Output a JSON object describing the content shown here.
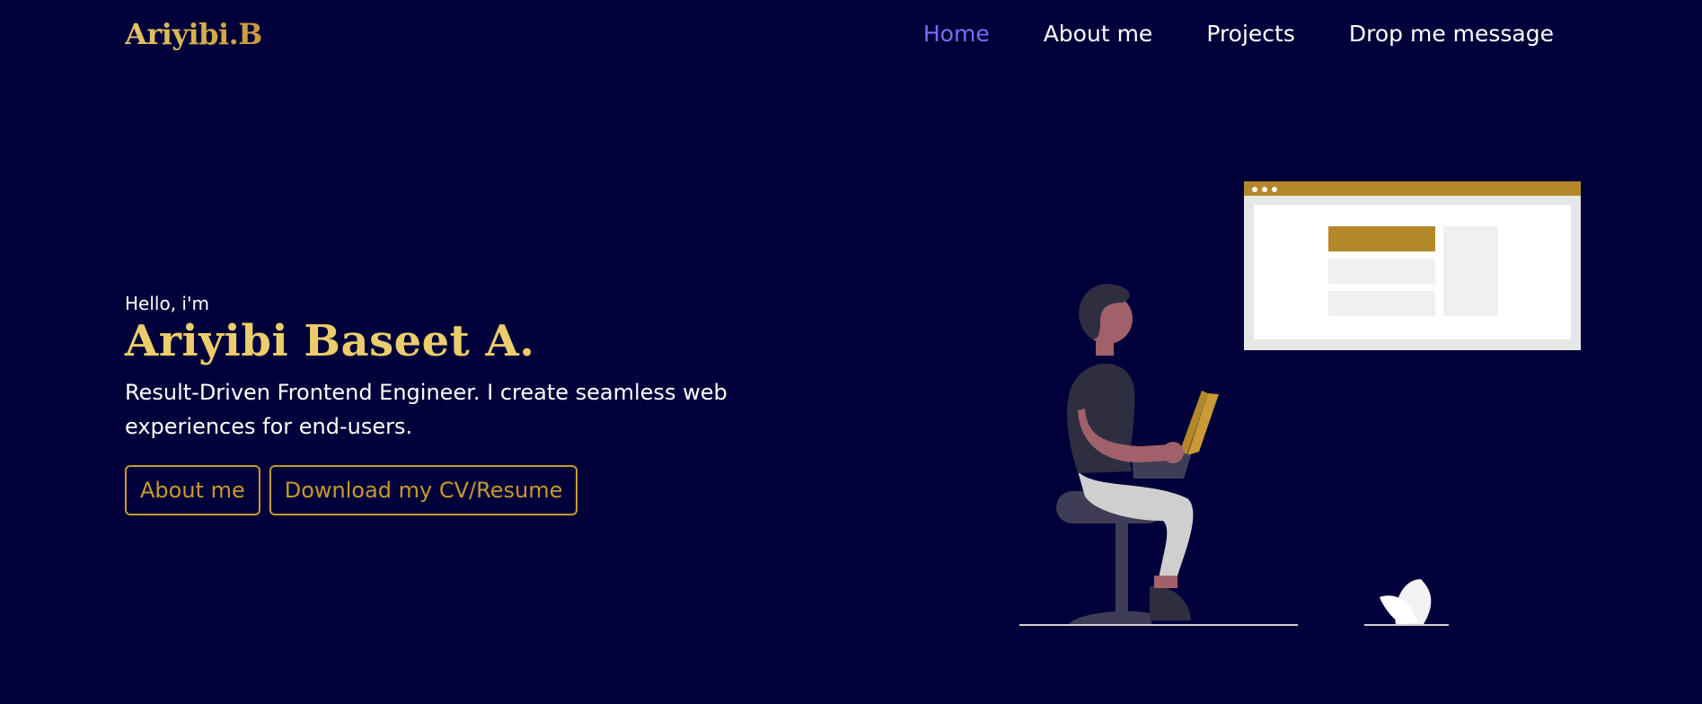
{
  "nav": {
    "logo": "Ariyibi.B",
    "links": [
      {
        "label": "Home",
        "active": true
      },
      {
        "label": "About me",
        "active": false
      },
      {
        "label": "Projects",
        "active": false
      },
      {
        "label": "Drop me message",
        "active": false
      }
    ]
  },
  "hero": {
    "greeting": "Hello, i'm",
    "name": "Ariyibi Baseet A.",
    "tagline": "Result-Driven Frontend Engineer. I create seamless web experiences for end-users.",
    "buttons": {
      "about_label": "About me",
      "cv_label": "Download my CV/Resume"
    }
  },
  "colors": {
    "background": "#00003a",
    "accent_gold": "#c79a2c",
    "name_gold": "#ebcd6b",
    "nav_active": "#7b6cf0",
    "text": "#ffffff"
  },
  "illustration": {
    "icon": "person-with-laptop-illustration"
  }
}
